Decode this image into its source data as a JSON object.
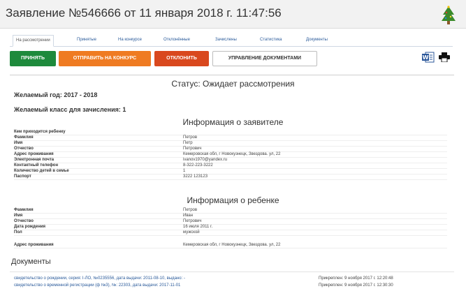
{
  "header": {
    "title": "Заявление №546666 от 11 января 2018 г. 11:47:56",
    "icon": "christmas-tree-icon"
  },
  "tabs": [
    {
      "label": "На рассмотрении",
      "active": true
    },
    {
      "label": "Принятые",
      "active": false
    },
    {
      "label": "На конкурсе",
      "active": false
    },
    {
      "label": "Отклонённые",
      "active": false
    },
    {
      "label": "Зачислены",
      "active": false
    },
    {
      "label": "Статистика",
      "active": false
    },
    {
      "label": "Документы",
      "active": false
    }
  ],
  "actions": {
    "accept": "ПРИНЯТЬ",
    "contest": "ОТПРАВИТЬ НА КОНКУРС",
    "reject": "ОТКЛОНИТЬ",
    "manage_docs": "УПРАВЛЕНИЕ ДОКУМЕНТАМИ"
  },
  "colors": {
    "accept": "#1e8a3c",
    "contest": "#ef7b22",
    "reject": "#d9481e",
    "link": "#2a5a9a"
  },
  "status": "Статус: Ожидает рассмотрения",
  "desired_year": "Желаемый год: 2017 - 2018",
  "desired_class": "Желаемый класс для зачисления: 1",
  "applicant": {
    "title": "Информация о заявителе",
    "rows": [
      {
        "label": "Кем приходится ребенку",
        "value": ""
      },
      {
        "label": "Фамилия",
        "value": "Петров"
      },
      {
        "label": "Имя",
        "value": "Петр"
      },
      {
        "label": "Отчество",
        "value": "Петрович"
      },
      {
        "label": "Адрес проживания",
        "value": "Кемеровская обл, г Новокузнецк, Звездова. ул, 22"
      },
      {
        "label": "Электронная почта",
        "value": "ivanov1970@yandex.ru"
      },
      {
        "label": "Контактный телефон",
        "value": "8-322-223-3222"
      },
      {
        "label": "Количество детей в семье",
        "value": "1"
      },
      {
        "label": "Паспорт",
        "value": "3222 123123"
      }
    ]
  },
  "child": {
    "title": "Информация о ребенке",
    "rows": [
      {
        "label": "Фамилия",
        "value": "Петров"
      },
      {
        "label": "Имя",
        "value": "Иван"
      },
      {
        "label": "Отчество",
        "value": "Петрович"
      },
      {
        "label": "Дата рождения",
        "value": "16 июля 2011 г."
      },
      {
        "label": "Пол",
        "value": "мужской"
      },
      {
        "label": "Адрес проживания",
        "value": "Кемеровская обл, г Новокузнецк, Звездова. ул, 22"
      }
    ]
  },
  "documents": {
    "title": "Документы",
    "items": [
      {
        "name": "свидетельство о рождении, серия: I-ЛО, №0235556, дата выдачи: 2011-08-10, выдано: -",
        "date": "Прикреплен: 9 ноября 2017 г. 12:20:48"
      },
      {
        "name": "свидетельство о временной регистрации (ф №3), №: 22303, дата выдачи: 2017-11-01",
        "date": "Прикреплен: 9 ноября 2017 г. 12:30:30"
      }
    ]
  }
}
